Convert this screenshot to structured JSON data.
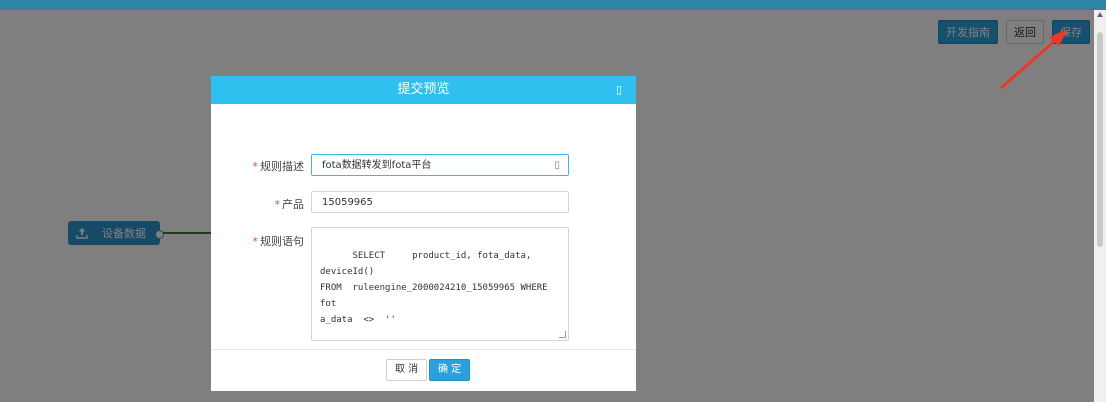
{
  "toolbar": {
    "dev_guide_label": "开发指南",
    "back_label": "返回",
    "save_label": "保存"
  },
  "canvas": {
    "node_label": "设备数据",
    "node_icon": "upload-icon"
  },
  "modal": {
    "title": "提交预览",
    "maximize_icon": "maximize-icon",
    "fields": {
      "description": {
        "label": "规则描述",
        "value": "fota数据转发到fota平台"
      },
      "product": {
        "label": "产品",
        "value": "15059965"
      },
      "statement": {
        "label": "规则语句",
        "value": "SELECT     product_id, fota_data, deviceId()\nFROM  ruleengine_2000024210_15059965 WHERE  fot\na_data  <>  ''"
      }
    },
    "required_mark": "*",
    "cancel_label": "取 消",
    "ok_label": "确 定"
  },
  "colors": {
    "accent": "#2aa1dc",
    "modal_header": "#2fc0f0",
    "annotation_arrow": "#e8392b"
  }
}
